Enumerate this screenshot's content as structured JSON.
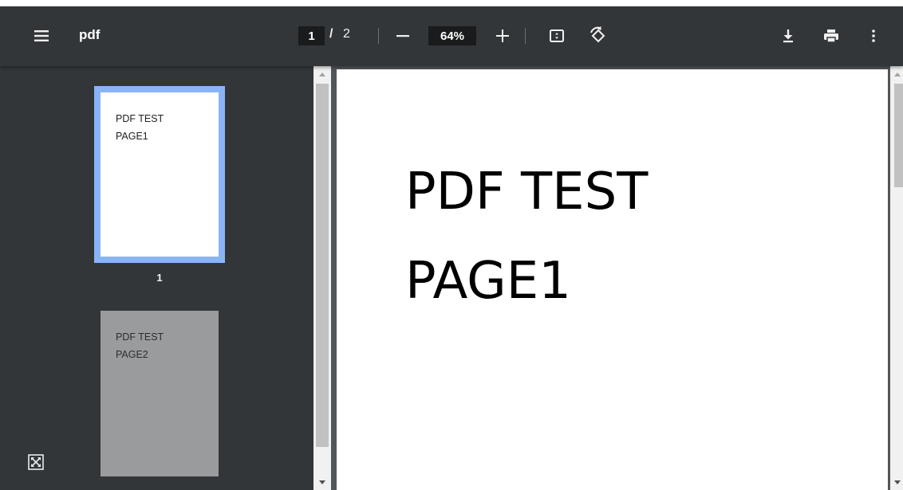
{
  "toolbar": {
    "title": "pdf",
    "current_page": "1",
    "page_separator": "/",
    "total_pages": "2",
    "zoom": "64%",
    "icons": [
      "menu-icon",
      "zoom-out-icon",
      "zoom-in-icon",
      "fit-page-icon",
      "rotate-icon",
      "download-icon",
      "print-icon",
      "more-icon"
    ]
  },
  "sidebar": {
    "thumbnails": [
      {
        "line1": "PDF TEST",
        "line2": "PAGE1",
        "label": "1",
        "selected": true
      },
      {
        "line1": "PDF TEST",
        "line2": "PAGE2",
        "label": "",
        "selected": false
      }
    ]
  },
  "document": {
    "page1": {
      "line1": "PDF TEST",
      "line2": "PAGE1"
    }
  },
  "colors": {
    "toolbar": "#323639",
    "sidebar": "#323639",
    "viewer": "#525659",
    "selection": "#8ab4f8"
  }
}
